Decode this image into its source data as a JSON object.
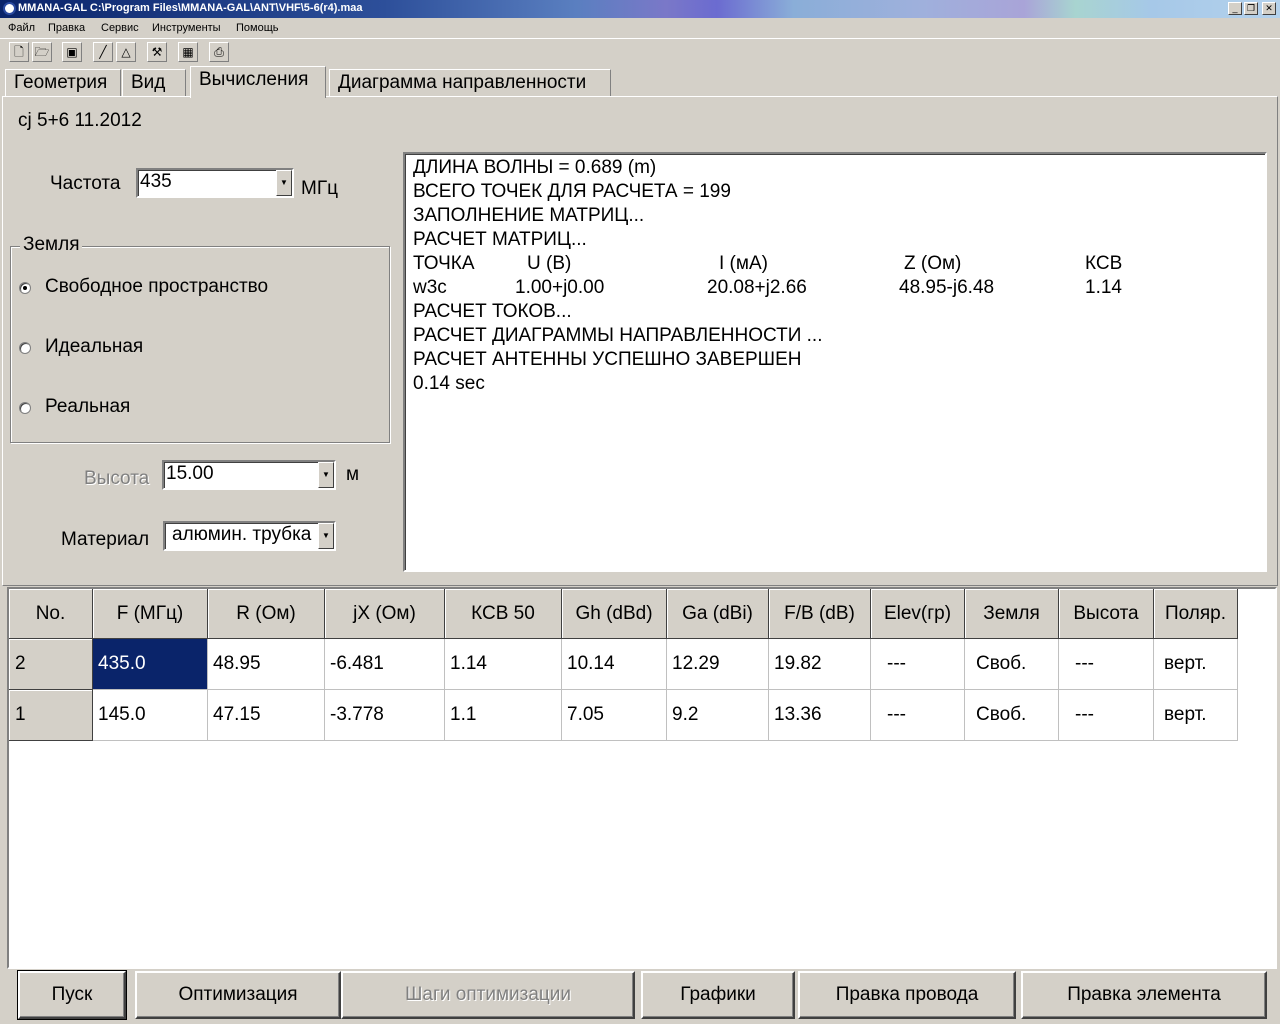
{
  "window": {
    "title": "MMANA-GAL C:\\Program Files\\MMANA-GAL\\ANT\\VHF\\5-6(r4).maa",
    "minimize_label": "_",
    "restore_label": "❐",
    "close_label": "✕"
  },
  "menu": {
    "items": [
      "Файл",
      "Правка",
      "Сервис",
      "Инструменты",
      "Помощь"
    ]
  },
  "toolbar": {
    "icons": [
      "new-file-icon",
      "open-folder-icon",
      "save-icon",
      "wire-icon",
      "triangle-icon",
      "tools-icon",
      "calculator-icon",
      "print-icon"
    ]
  },
  "tabs": [
    {
      "label": "Геометрия",
      "active": false
    },
    {
      "label": "Вид",
      "active": false
    },
    {
      "label": "Вычисления",
      "active": true
    },
    {
      "label": "Диаграмма направленности",
      "active": false
    }
  ],
  "calc": {
    "antenna_name": "cj 5+6 11.2012",
    "freq_label": "Частота",
    "freq_value": "435",
    "freq_unit": "МГц",
    "ground_title": "Земля",
    "ground_options": [
      {
        "label": "Свободное пространство",
        "checked": true
      },
      {
        "label": "Идеальная",
        "checked": false
      },
      {
        "label": "Реальная",
        "checked": false
      }
    ],
    "height_label": "Высота",
    "height_value": "15.00",
    "height_unit": "м",
    "material_label": "Материал",
    "material_value": "алюмин. трубка"
  },
  "log": {
    "lines": [
      "ДЛИНА ВОЛНЫ = 0.689 (m)",
      "ВСЕГО ТОЧЕК ДЛЯ РАСЧЕТА = 199",
      "ЗАПОЛНЕНИЕ МАТРИЦ...",
      "РАСЧЕТ МАТРИЦ..."
    ],
    "table_header": [
      "ТОЧКА",
      "U (B)",
      "I (мА)",
      "Z (Ом)",
      "КСВ"
    ],
    "table_row": [
      "w3c",
      "1.00+j0.00",
      "20.08+j2.66",
      "48.95-j6.48",
      "1.14"
    ],
    "lines_after": [
      "РАСЧЕТ ТОКОВ...",
      "РАСЧЕТ ДИАГРАММЫ НАПРАВЛЕННОСТИ ...",
      "РАСЧЕТ АНТЕННЫ УСПЕШНО ЗАВЕРШЕН",
      "0.14 sec"
    ]
  },
  "grid": {
    "headers": [
      "No.",
      "F (МГц)",
      "R (Ом)",
      "jX (Ом)",
      "КСВ 50",
      "Gh (dBd)",
      "Ga (dBi)",
      "F/B (dB)",
      "Elev(гр)",
      "Земля",
      "Высота",
      "Поляр."
    ],
    "rows": [
      [
        "2",
        "435.0",
        "48.95",
        "-6.481",
        "1.14",
        "10.14",
        "12.29",
        "19.82",
        "---",
        "Своб.",
        "---",
        "верт."
      ],
      [
        "1",
        "145.0",
        "47.15",
        "-3.778",
        "1.1",
        "7.05",
        "9.2",
        "13.36",
        "---",
        "Своб.",
        "---",
        "верт."
      ]
    ]
  },
  "buttons": {
    "start": "Пуск",
    "optimize": "Оптимизация",
    "opt_steps": "Шаги оптимизации",
    "graphs": "Графики",
    "edit_wire": "Правка провода",
    "edit_element": "Правка элемента"
  }
}
